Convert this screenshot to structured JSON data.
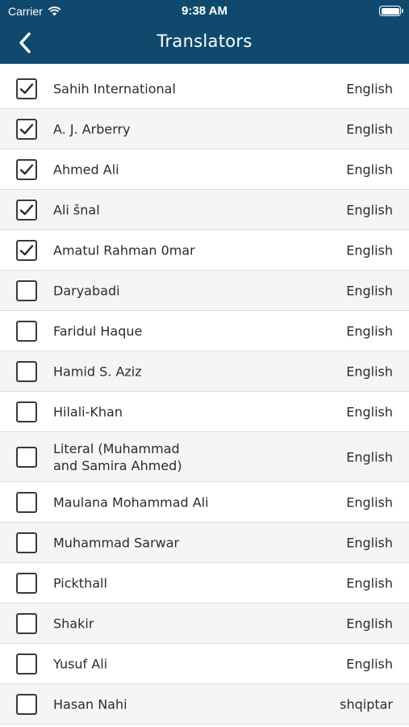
{
  "status_bar": {
    "carrier": "Carrier",
    "time": "9:38 AM"
  },
  "nav": {
    "title": "Translators",
    "back_icon": "chevron-left-icon"
  },
  "colors": {
    "nav_background": "#0f4a6e",
    "row_alt": "#f5f5f5"
  },
  "translators": [
    {
      "name": "Sahih International",
      "language": "English",
      "checked": true
    },
    {
      "name": "A. J. Arberry",
      "language": "English",
      "checked": true
    },
    {
      "name": "Ahmed Ali",
      "language": "English",
      "checked": true
    },
    {
      "name": "Ali šnal",
      "language": "English",
      "checked": true
    },
    {
      "name": "Amatul Rahman 0mar",
      "language": "English",
      "checked": true
    },
    {
      "name": "Daryabadi",
      "language": "English",
      "checked": false
    },
    {
      "name": "Faridul Haque",
      "language": "English",
      "checked": false
    },
    {
      "name": "Hamid S. Aziz",
      "language": "English",
      "checked": false
    },
    {
      "name": "Hilali-Khan",
      "language": "English",
      "checked": false
    },
    {
      "name": "Literal (Muhammad\nand Samira Ahmed)",
      "language": "English",
      "checked": false
    },
    {
      "name": "Maulana Mohammad Ali",
      "language": "English",
      "checked": false
    },
    {
      "name": "Muhammad Sarwar",
      "language": "English",
      "checked": false
    },
    {
      "name": "Pickthall",
      "language": "English",
      "checked": false
    },
    {
      "name": "Shakir",
      "language": "English",
      "checked": false
    },
    {
      "name": "Yusuf Ali",
      "language": "English",
      "checked": false
    },
    {
      "name": "Hasan Nahi",
      "language": "shqiptar",
      "checked": false
    }
  ]
}
